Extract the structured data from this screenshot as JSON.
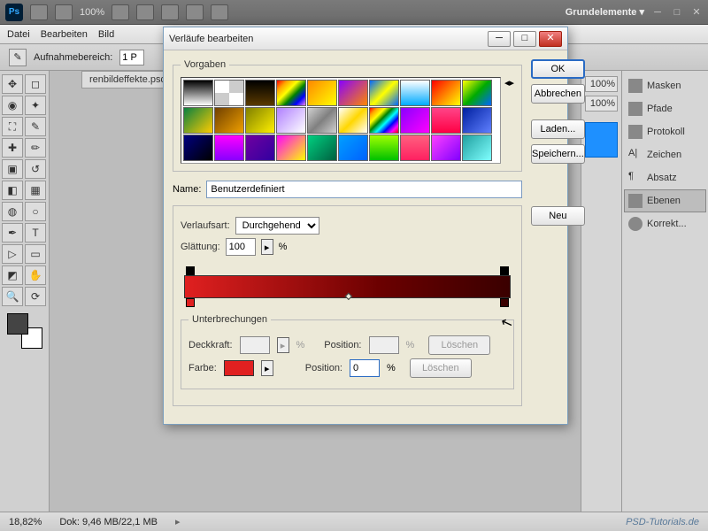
{
  "app": {
    "zoom_toolbar": "100%",
    "workspace": "Grundelemente ▾"
  },
  "menu": [
    "Datei",
    "Bearbeiten",
    "Bild"
  ],
  "options": {
    "label": "Aufnahmebereich:",
    "value": "1 P"
  },
  "doc_tab": "renbildeffekte.psd",
  "panels": [
    {
      "label": "Masken"
    },
    {
      "label": "Pfade"
    },
    {
      "label": "Protokoll"
    },
    {
      "label": "Zeichen"
    },
    {
      "label": "Absatz"
    },
    {
      "label": "Ebenen",
      "active": true
    },
    {
      "label": "Korrekt..."
    }
  ],
  "status": {
    "zoom": "18,82%",
    "doc": "Dok: 9,46 MB/22,1 MB",
    "watermark": "PSD-Tutorials.de"
  },
  "dialog": {
    "title": "Verläufe bearbeiten",
    "presets_legend": "Vorgaben",
    "buttons": {
      "ok": "OK",
      "cancel": "Abbrechen",
      "load": "Laden...",
      "save": "Speichern...",
      "new": "Neu",
      "delete": "Löschen"
    },
    "name_label": "Name:",
    "name_value": "Benutzerdefiniert",
    "type_label": "Verlaufsart:",
    "type_value": "Durchgehend",
    "smooth_label": "Glättung:",
    "smooth_value": "100",
    "pct": "%",
    "interrupts_legend": "Unterbrechungen",
    "opacity_label": "Deckkraft:",
    "position_label": "Position:",
    "color_label": "Farbe:",
    "position_value": "0",
    "gradient": {
      "start": "#e02020",
      "end": "#3a0000"
    }
  },
  "preset_gradients": [
    "linear-gradient(#000,#fff)",
    "repeating-conic-gradient(#ccc 0 25%,#fff 0 50%)",
    "linear-gradient(#000,#5a3a00)",
    "linear-gradient(135deg,red,orange,yellow,green,blue,violet)",
    "linear-gradient(135deg,#f80,#ff0)",
    "linear-gradient(135deg,#80f,#f80)",
    "linear-gradient(135deg,#06f,#ff0,#06f)",
    "linear-gradient(#fff,#0af)",
    "linear-gradient(135deg,red,yellow)",
    "linear-gradient(135deg,#ff0,#0a0,#06f)",
    "linear-gradient(135deg,#0a8040,#ffcc00)",
    "linear-gradient(135deg,#704000,#f0a000)",
    "linear-gradient(135deg,#808000,#fff000)",
    "linear-gradient(135deg,#b080ff,#fff)",
    "linear-gradient(135deg,#d0d0d0,#808080,#d0d0d0)",
    "linear-gradient(135deg,#fff,#ffd700,#fff)",
    "linear-gradient(135deg,red,orange,yellow,green,cyan,blue,magenta,red)",
    "linear-gradient(135deg,#80f,#f0f)",
    "linear-gradient(#f48,#f04)",
    "linear-gradient(135deg,#0020a0,#6080ff)",
    "linear-gradient(135deg,#000080,#000)",
    "linear-gradient(#f0f,#80f)",
    "linear-gradient(135deg,#7000a0,#3000a0)",
    "linear-gradient(135deg,#ff00ff,#ffff00)",
    "linear-gradient(135deg,#00d080,#006040)",
    "linear-gradient(135deg,#00a0ff,#0060ff)",
    "linear-gradient(#a0ff00,#00c000)",
    "linear-gradient(#ff6080,#ff2060)",
    "linear-gradient(135deg,#ff40ff,#8000ff)",
    "linear-gradient(135deg,#20a0a0,#80ffff)"
  ],
  "side_percent": "100%"
}
